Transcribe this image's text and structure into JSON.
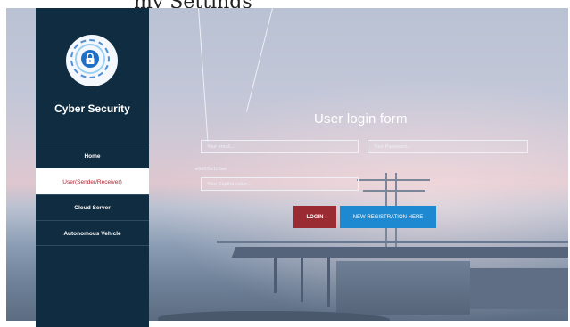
{
  "page": {
    "top_overflow_text": "my Settings"
  },
  "sidebar": {
    "brand": "Cyber Security",
    "logo_icon": "padlock-shield-icon",
    "nav": [
      {
        "label": "Home",
        "active": false
      },
      {
        "label": "User(Sender/Receiver)",
        "active": true
      },
      {
        "label": "Cloud Server",
        "active": false
      },
      {
        "label": "Autonomous Vehicle",
        "active": false
      }
    ]
  },
  "form": {
    "title": "User login form",
    "email_placeholder": "Your email...",
    "password_placeholder": "Your Password...",
    "captcha_code": "e8d8f6e1c5ae",
    "captcha_placeholder": "Your Captha value...",
    "login_label": "LOGIN",
    "register_label": "NEW REGISTRATION HERE"
  },
  "colors": {
    "sidebar_bg": "#0f2c40",
    "active_nav_text": "#b11e2b",
    "login_button": "#9b2b33",
    "register_button": "#1e88d0"
  }
}
